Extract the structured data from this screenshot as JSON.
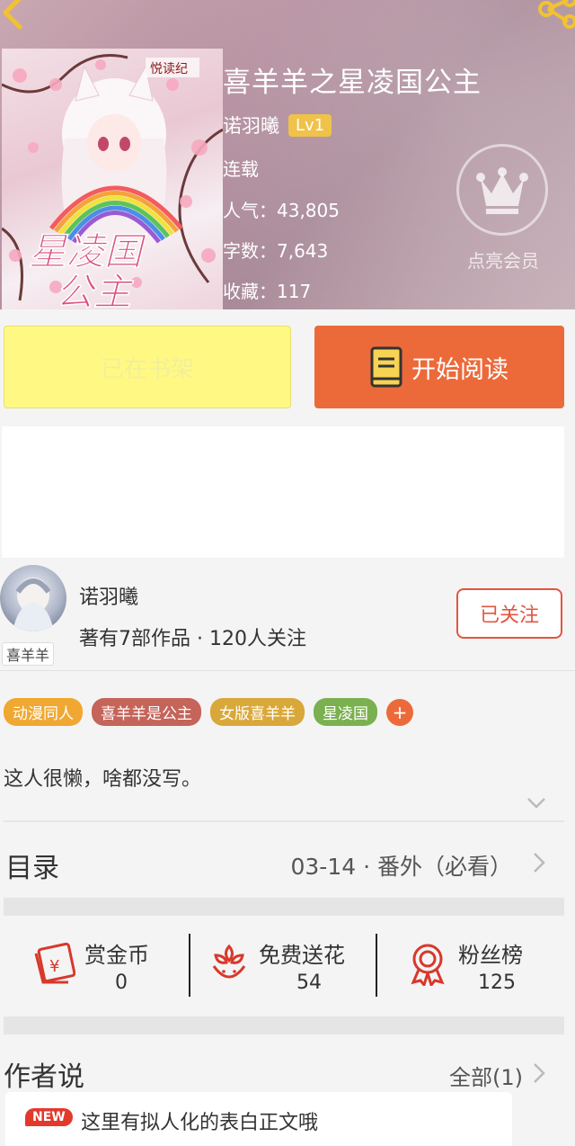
{
  "book": {
    "title": "喜羊羊之星凌国公主",
    "author": "诺羽曦",
    "level": "Lv1",
    "status": "连载",
    "popularity": "人气：43,805",
    "word_count": "字数：7,643",
    "favorites": "收藏：117",
    "cover_title_art": "星凌国公主",
    "cover_publisher_mark": "悦读纪"
  },
  "member": {
    "label": "点亮会员",
    "icon": "crown-icon"
  },
  "actions": {
    "shelf_label": "已在书架",
    "read_label": "开始阅读"
  },
  "author_card": {
    "name": "诺羽曦",
    "avatar_tag": "喜羊羊",
    "stats": "著有7部作品 · 120人关注",
    "follow_label": "已关注"
  },
  "tags": [
    {
      "label": "动漫同人",
      "color": "#f0a832"
    },
    {
      "label": "喜羊羊是公主",
      "color": "#c4645a"
    },
    {
      "label": "女版喜羊羊",
      "color": "#d9a83a"
    },
    {
      "label": "星凌国",
      "color": "#7bb050"
    }
  ],
  "tag_add": "+",
  "description": "这人很懒，啥都没写。",
  "catalog": {
    "title": "目录",
    "latest": "03-14 · 番外（必看）"
  },
  "stats": [
    {
      "label": "赏金币",
      "value": "0",
      "icon": "red-envelope-icon"
    },
    {
      "label": "免费送花",
      "value": "54",
      "icon": "flower-icon"
    },
    {
      "label": "粉丝榜",
      "value": "125",
      "icon": "award-ribbon-icon"
    }
  ],
  "author_says": {
    "title": "作者说",
    "all_label": "全部(1)",
    "badge": "NEW",
    "latest_text": "这里有拟人化的表白正文哦"
  },
  "colors": {
    "accent": "#ec6a3a",
    "shelf_button": "#fff984",
    "follow": "#e25540",
    "level_badge": "#f0c24a"
  }
}
